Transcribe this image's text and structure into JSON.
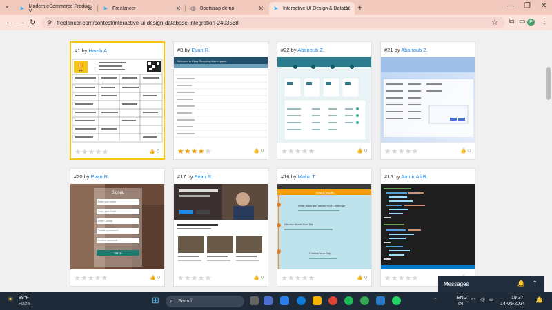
{
  "browser": {
    "tabs": [
      {
        "title": "Modern eCommerce Product V",
        "active": false
      },
      {
        "title": "Freelancer",
        "active": false
      },
      {
        "title": "Bootstrap demo",
        "active": false
      },
      {
        "title": "Interactive UI Design & Databa",
        "active": true
      }
    ],
    "url": "freelancer.com/contest/interactive-ui-design-database-integration-2403568",
    "avatar_letter": "P"
  },
  "entries": [
    {
      "number": "#1",
      "by": "by",
      "author": "Harsh A.",
      "rating": 0,
      "likes": "0",
      "selected": true
    },
    {
      "number": "#8",
      "by": "by",
      "author": "Evan R.",
      "rating": 4,
      "likes": "0",
      "selected": false
    },
    {
      "number": "#22",
      "by": "by",
      "author": "Abanoub Z.",
      "rating": 0,
      "likes": "0",
      "selected": false
    },
    {
      "number": "#21",
      "by": "by",
      "author": "Abanoub Z.",
      "rating": 0,
      "likes": "0",
      "selected": false
    },
    {
      "number": "#20",
      "by": "by",
      "author": "Evan R.",
      "rating": 0,
      "likes": "0",
      "selected": false
    },
    {
      "number": "#17",
      "by": "by",
      "author": "Evan R.",
      "rating": 0,
      "likes": "0",
      "selected": false
    },
    {
      "number": "#16",
      "by": "by",
      "author": "Maha T",
      "rating": 0,
      "likes": "0",
      "selected": false
    },
    {
      "number": "#15",
      "by": "by",
      "author": "Aamir Ali B.",
      "rating": 0,
      "likes": "0",
      "selected": false
    }
  ],
  "thumbs": {
    "t8_title": "Welcome to Ebay Shopping Admin panel",
    "t20_title": "Signup",
    "t20_fields": [
      "Enter your name",
      "Enter your Email",
      "Enter Contact",
      "Create a password",
      "Confirm password"
    ],
    "t20_button": "Signup",
    "t16_header": "How it Works",
    "t16_steps": [
      "Write down and create Your Challenge",
      "Discuss About Your Trip",
      "Confirm Your Trip"
    ]
  },
  "messages": {
    "label": "Messages"
  },
  "taskbar": {
    "temp": "88°F",
    "weather": "Haze",
    "search": "Search",
    "lang1": "ENG",
    "lang2": "IN",
    "time": "19:37",
    "date": "14-05-2024"
  },
  "colors": {
    "accent": "#1e88e5",
    "star_on": "#e8a317",
    "selected": "#f5c518"
  }
}
